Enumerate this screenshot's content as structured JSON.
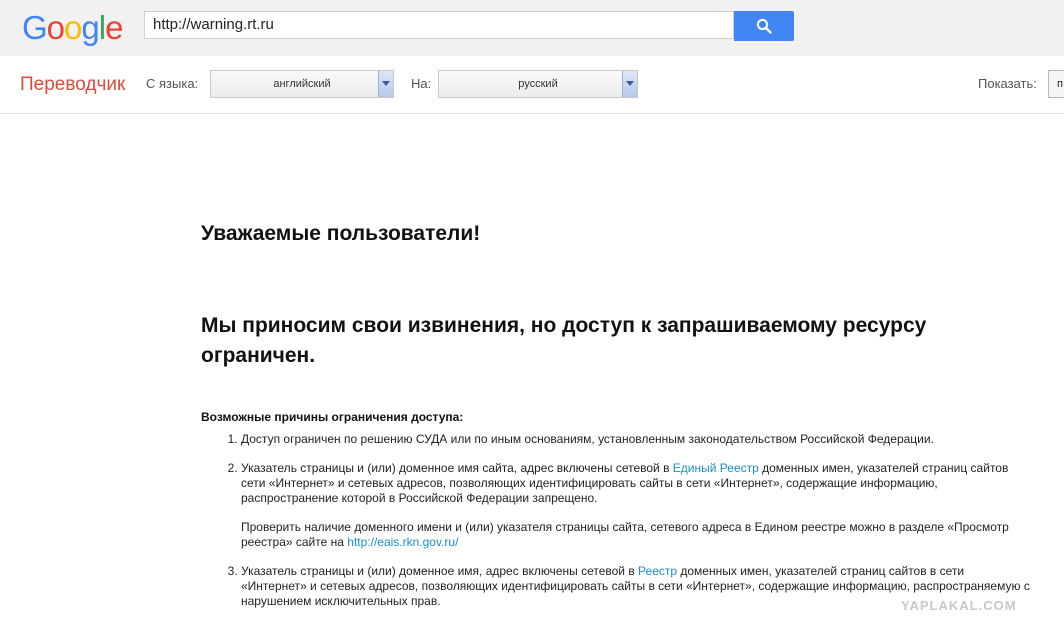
{
  "header": {
    "logo_parts": [
      "G",
      "o",
      "o",
      "g",
      "l",
      "e"
    ],
    "url": "http://warning.rt.ru",
    "search_icon": "search-icon"
  },
  "translate_bar": {
    "brand": "Переводчик",
    "from_label": "С языка:",
    "from_value": "английский",
    "to_label": "На:",
    "to_value": "русский",
    "show_label": "Показать:",
    "show_value": "п"
  },
  "page": {
    "heading1": "Уважаемые пользователи!",
    "heading2": "Мы приносим свои извинения, но доступ к запрашиваемому ресурсу ограничен.",
    "reasons_title": "Возможные причины ограничения доступа:",
    "reason1": "Доступ ограничен по решению СУДА или по иным основаниям, установленным законодательством Российской Федерации.",
    "reason2_pre": "Указатель страницы и (или) доменное имя сайта, адрес включены сетевой в ",
    "reason2_link": "Единый Реестр",
    "reason2_post": " доменных имен, указателей страниц сайтов сети «Интернет» и сетевых адресов, позволяющих идентифицировать сайты в сети «Интернет», содержащие информацию, распространение которой в Российской Федерации запрещено.",
    "reason2_check_pre": "Проверить наличие доменного имени и (или) указателя страницы сайта, сетевого адреса в Едином реестре можно в разделе «Просмотр реестра» сайте на ",
    "reason2_check_link": "http://eais.rkn.gov.ru/",
    "reason3_pre": "Указатель страницы и (или) доменное имя, адрес включены сетевой в ",
    "reason3_link": "Реестр",
    "reason3_post": " доменных имен, указателей страниц сайтов в сети «Интернет» и сетевых адресов, позволяющих идентифицировать сайты в сети «Интернет», содержащие информацию, распространяемую с нарушением исключительных прав."
  },
  "watermark": "YAPLAKAL.COM"
}
